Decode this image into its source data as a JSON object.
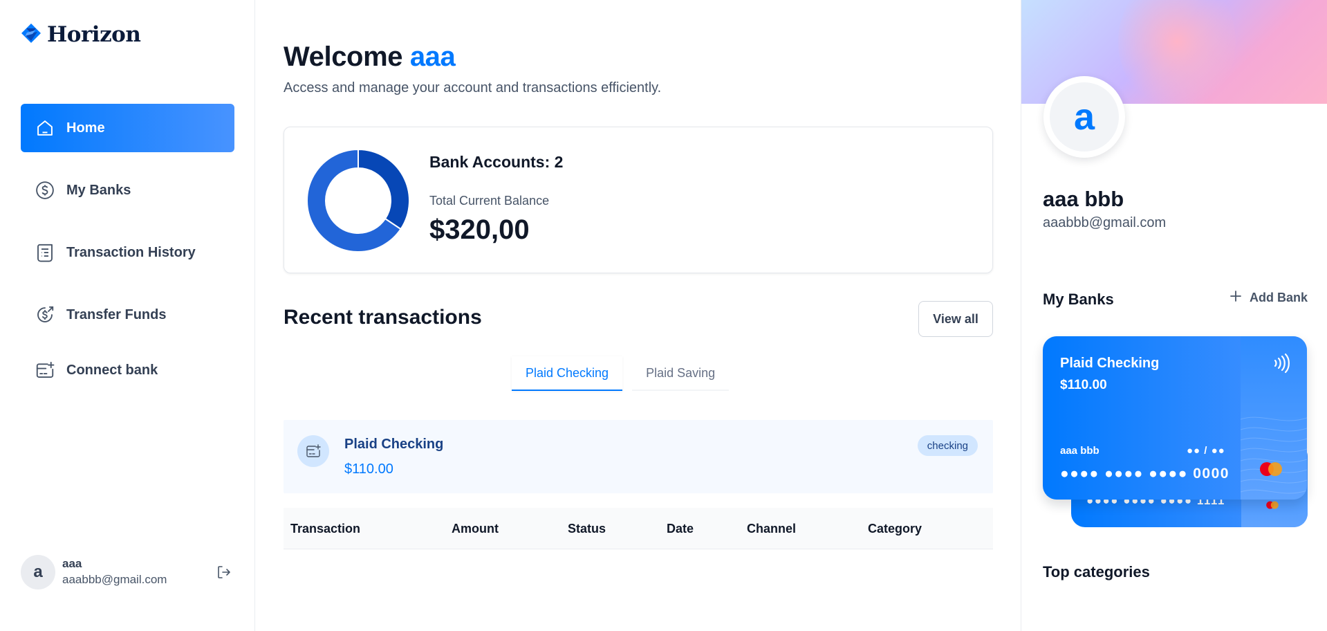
{
  "brand": {
    "name": "Horizon"
  },
  "nav": {
    "items": [
      {
        "label": "Home",
        "icon": "home-icon",
        "active": true
      },
      {
        "label": "My Banks",
        "icon": "dollar-circle-icon"
      },
      {
        "label": "Transaction History",
        "icon": "receipt-icon"
      },
      {
        "label": "Transfer Funds",
        "icon": "money-send-icon"
      },
      {
        "label": "Connect bank",
        "icon": "card-add-icon"
      }
    ]
  },
  "footer": {
    "avatar_initial": "a",
    "name": "aaa",
    "email": "aaabbb@gmail.com",
    "logout_icon": "logout-icon"
  },
  "header": {
    "greeting": "Welcome",
    "user_name": "aaa",
    "subtitle": "Access and manage your account and transactions efficiently."
  },
  "balance": {
    "bank_accounts_label": "Bank Accounts: 2",
    "total_label": "Total Current Balance",
    "total_value": "$320,00",
    "donut": [
      {
        "name": "Plaid Checking",
        "value": 110,
        "color": "#0747b6"
      },
      {
        "name": "Plaid Saving",
        "value": 210,
        "color": "#2265d8"
      }
    ]
  },
  "recent": {
    "title": "Recent transactions",
    "view_all": "View all",
    "tabs": [
      {
        "label": "Plaid Checking",
        "active": true
      },
      {
        "label": "Plaid Saving",
        "active": false
      }
    ],
    "bank": {
      "name": "Plaid Checking",
      "amount": "$110.00",
      "type": "checking"
    },
    "columns": [
      "Transaction",
      "Amount",
      "Status",
      "Date",
      "Channel",
      "Category"
    ]
  },
  "profile": {
    "initial": "a",
    "full_name": "aaa bbb",
    "email": "aaabbb@gmail.com"
  },
  "my_banks": {
    "title": "My Banks",
    "add_bank": "Add Bank",
    "cards": [
      {
        "name": "Plaid Checking",
        "balance": "$110.00",
        "holder": "aaa bbb",
        "expiry": "●● / ●●",
        "number": "●●●● ●●●● ●●●● 0000"
      },
      {
        "number": "●●●● ●●●● ●●●● 1111"
      }
    ]
  },
  "top_categories": {
    "title": "Top categories"
  },
  "colors": {
    "accent": "#0179fe",
    "text_dark": "#101828",
    "text_muted": "#475467",
    "border": "#eaecf0"
  }
}
